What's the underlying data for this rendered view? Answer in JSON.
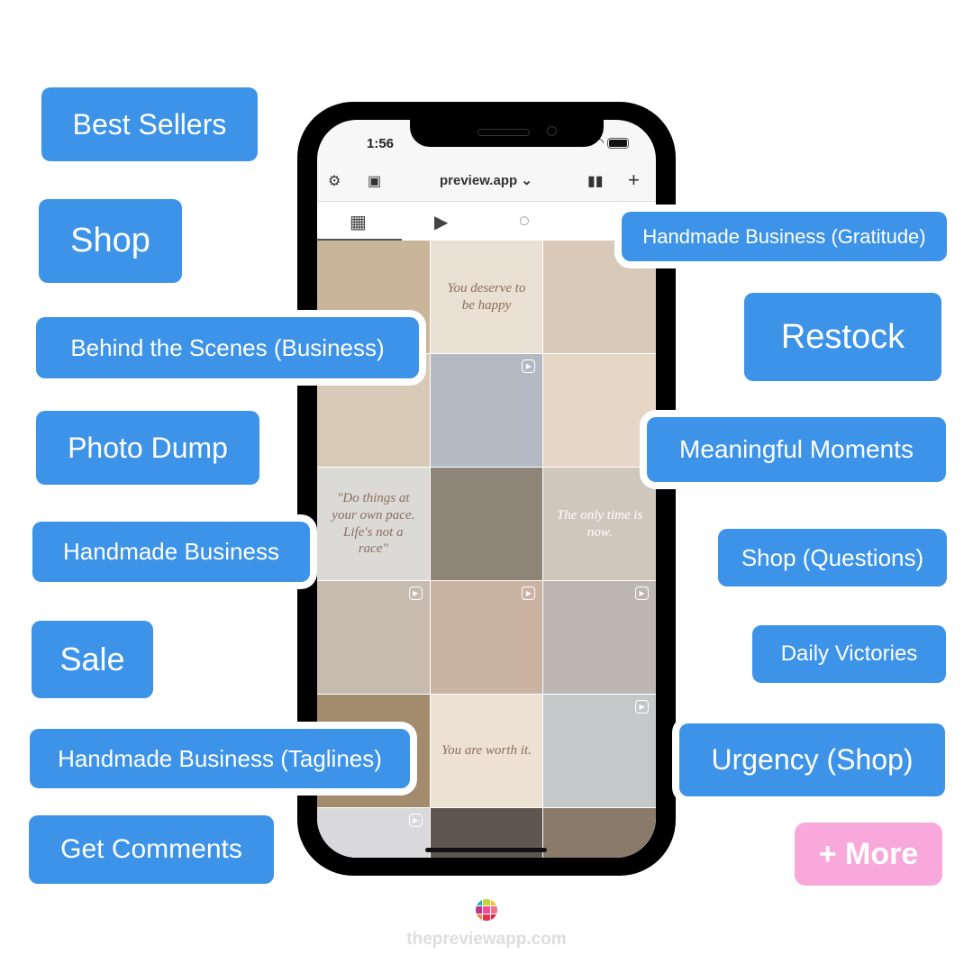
{
  "phone": {
    "time": "1:56",
    "app_title": "preview.app",
    "chevron": "⌄",
    "tiles": [
      {
        "color": "#c9b59a",
        "text": "",
        "reel": false
      },
      {
        "color": "#eadfd3",
        "text": "You deserve to be happy",
        "reel": false
      },
      {
        "color": "#d8c9b8",
        "text": "",
        "reel": false
      },
      {
        "color": "#d9cab8",
        "text": "",
        "reel": false
      },
      {
        "color": "#b4bac4",
        "text": "",
        "reel": true
      },
      {
        "color": "#e5d6c6",
        "text": "",
        "reel": false
      },
      {
        "color": "#dcdad7",
        "text": "\"Do things at your own pace. Life's not a race\"",
        "reel": false
      },
      {
        "color": "#8f8478",
        "text": "",
        "reel": false
      },
      {
        "color": "#cfc6bc",
        "text": "The only time is now.",
        "reel": false
      },
      {
        "color": "#c7bbb0",
        "text": "",
        "reel": true
      },
      {
        "color": "#cbb3a4",
        "text": "",
        "reel": true
      },
      {
        "color": "#bdb7b1",
        "text": "",
        "reel": true
      },
      {
        "color": "#a38b6d",
        "text": "",
        "reel": false
      },
      {
        "color": "#ede1d4",
        "text": "You are worth it.",
        "reel": false
      },
      {
        "color": "#c5c8c8",
        "text": "",
        "reel": true
      },
      {
        "color": "#d9d9dc",
        "text": "",
        "reel": true
      },
      {
        "color": "#5d574f",
        "text": "",
        "reel": false
      },
      {
        "color": "#8a7a6a",
        "text": "",
        "reel": false
      }
    ]
  },
  "labels": {
    "best_sellers": "Best Sellers",
    "shop": "Shop",
    "behind": "Behind the Scenes (Business)",
    "photo_dump": "Photo Dump",
    "handmade": "Handmade Business",
    "sale": "Sale",
    "taglines": "Handmade Business (Taglines)",
    "get_comments": "Get Comments",
    "gratitude": "Handmade Business (Gratitude)",
    "restock": "Restock",
    "meaningful": "Meaningful Moments",
    "shop_questions": "Shop (Questions)",
    "daily": "Daily Victories",
    "urgency": "Urgency (Shop)",
    "more": "+ More"
  },
  "colors": {
    "label_blue": "#3d93e8",
    "more_pink": "#f9a8dc"
  },
  "footer": {
    "site": "thepreviewapp.com"
  }
}
